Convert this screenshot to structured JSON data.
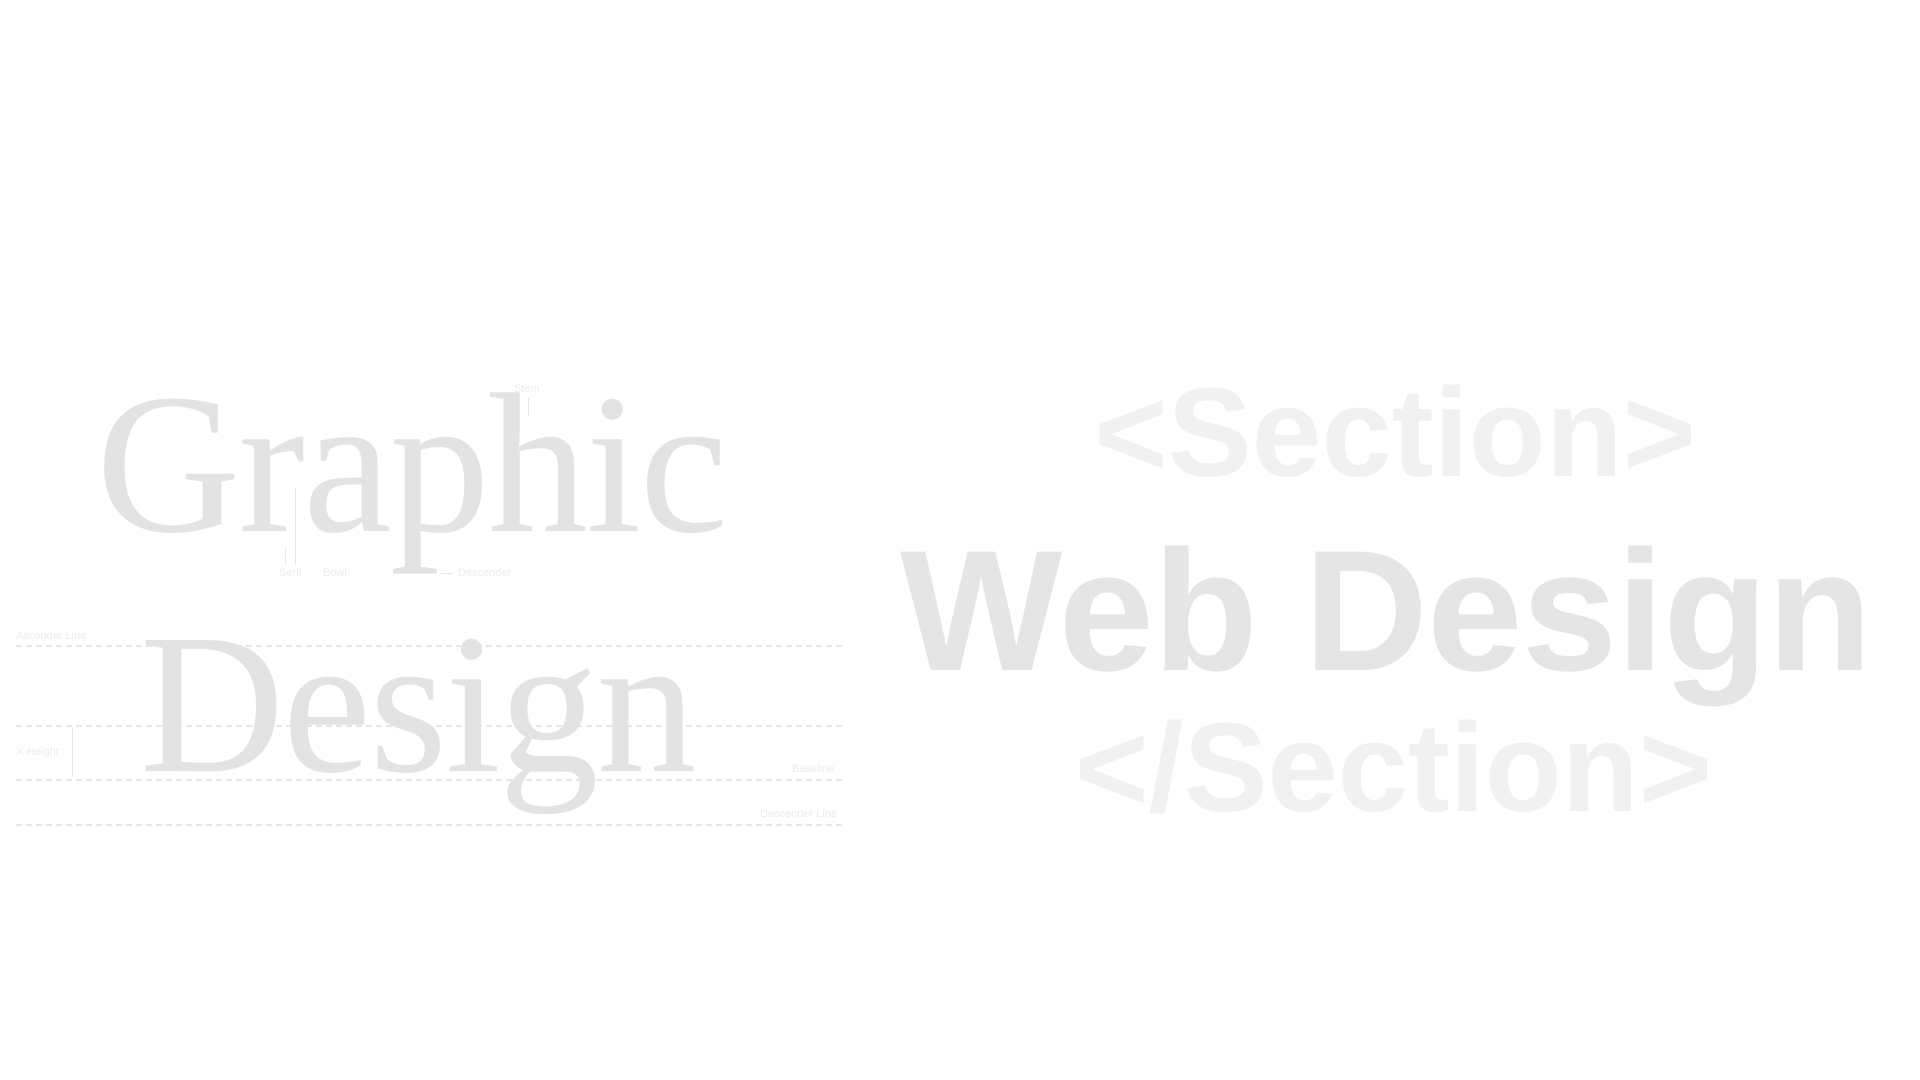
{
  "typography": {
    "word_top": "Graphic",
    "word_bottom": "Design",
    "annotations": {
      "stem": "Stem",
      "serif": "Serif",
      "bowl": "Bowl",
      "descender": "Descender",
      "ascender_line": "Ascender Line",
      "x_height": "X-Height",
      "baseline": "Baseline",
      "descender_line": "Descender Line"
    }
  },
  "headings": {
    "open_tag": "<Section>",
    "main": "Web Design",
    "close_tag": "</Section>"
  },
  "colors": {
    "background": "#ffffff",
    "serif_text": "#e3e3e3",
    "heading_main": "#e5e5e5",
    "heading_tags": "#f1f1f1"
  }
}
